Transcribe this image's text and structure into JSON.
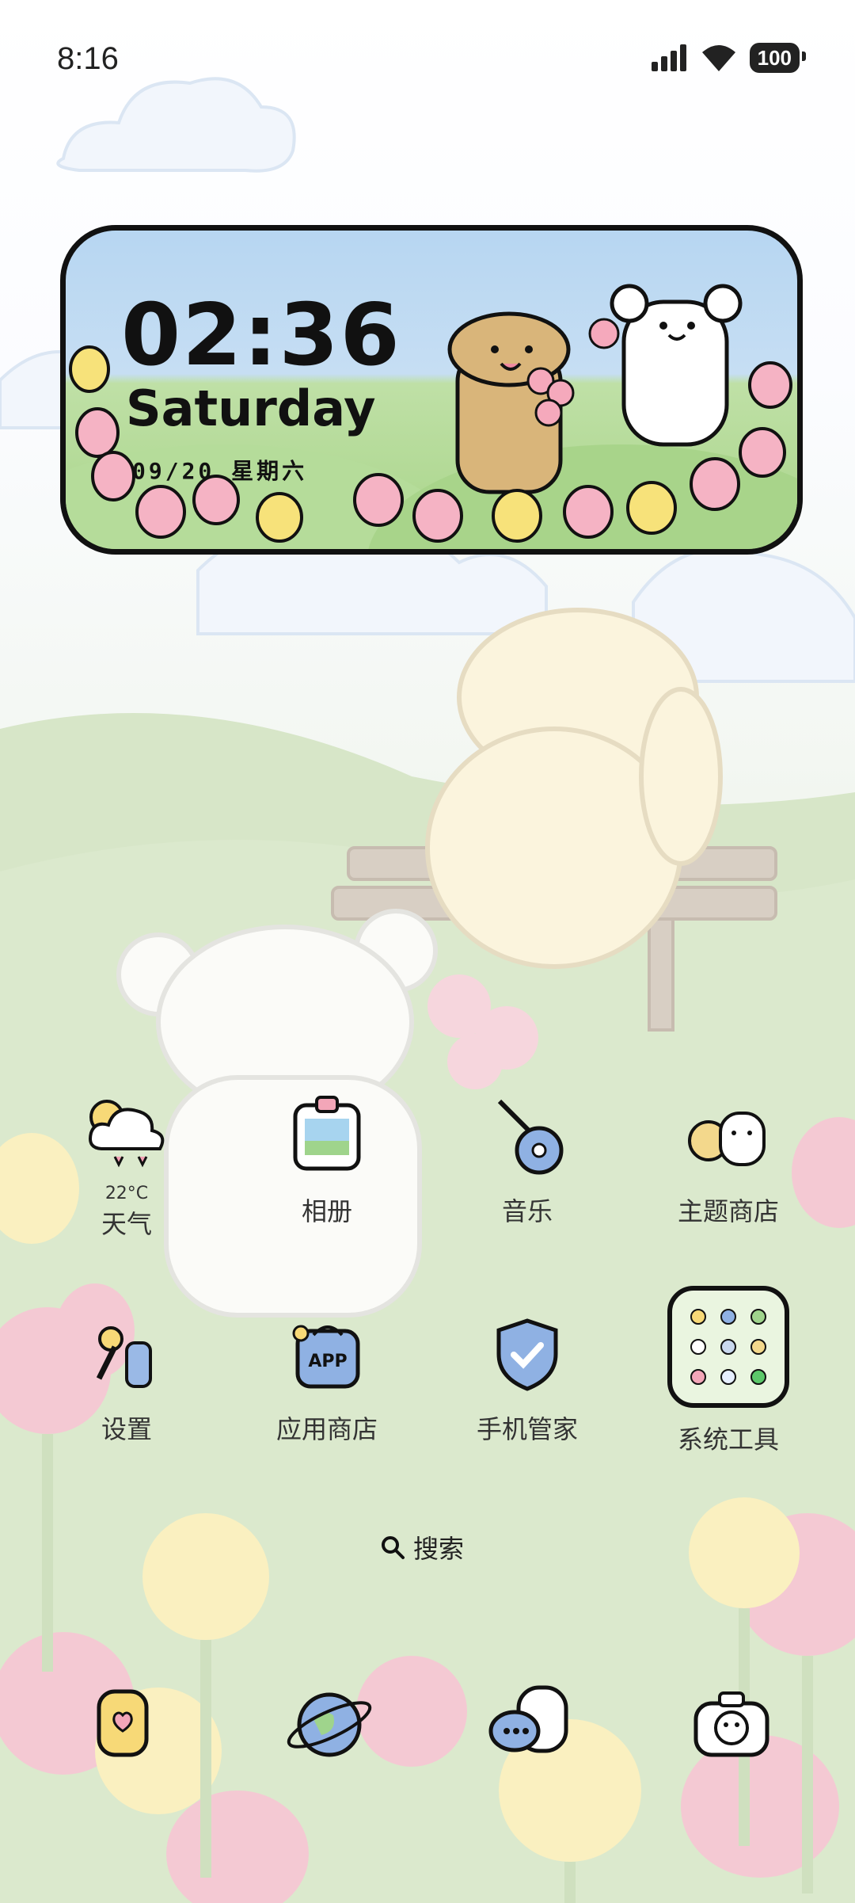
{
  "status_bar": {
    "time": "8:16",
    "battery": "100"
  },
  "clock_widget": {
    "time": "02:36",
    "weekday": "Saturday",
    "date": "09/20 星期六"
  },
  "apps": [
    {
      "label": "天气",
      "sub": "22°C",
      "icon": "weather-cloud-icon"
    },
    {
      "label": "相册",
      "icon": "photo-album-icon"
    },
    {
      "label": "音乐",
      "icon": "guitar-music-icon"
    },
    {
      "label": "主题商店",
      "icon": "theme-store-icon"
    },
    {
      "label": "设置",
      "icon": "settings-wrench-icon"
    },
    {
      "label": "应用商店",
      "icon": "app-store-bag-icon"
    },
    {
      "label": "手机管家",
      "icon": "phone-manager-shield-icon"
    },
    {
      "label": "系统工具",
      "icon": "system-tools-folder-icon"
    }
  ],
  "search": {
    "label": "搜索"
  },
  "dock": [
    {
      "icon": "phone-dialer-icon"
    },
    {
      "icon": "browser-planet-icon"
    },
    {
      "icon": "messages-icon"
    },
    {
      "icon": "camera-icon"
    }
  ],
  "colors": {
    "widget_sky": "#b7d6f2",
    "widget_grass": "#a9d58a",
    "icon_blue": "#9ab9e6",
    "icon_outline": "#1a1a1a",
    "tulip_pink": "#f4b7c6",
    "tulip_yellow": "#f8e89a"
  }
}
